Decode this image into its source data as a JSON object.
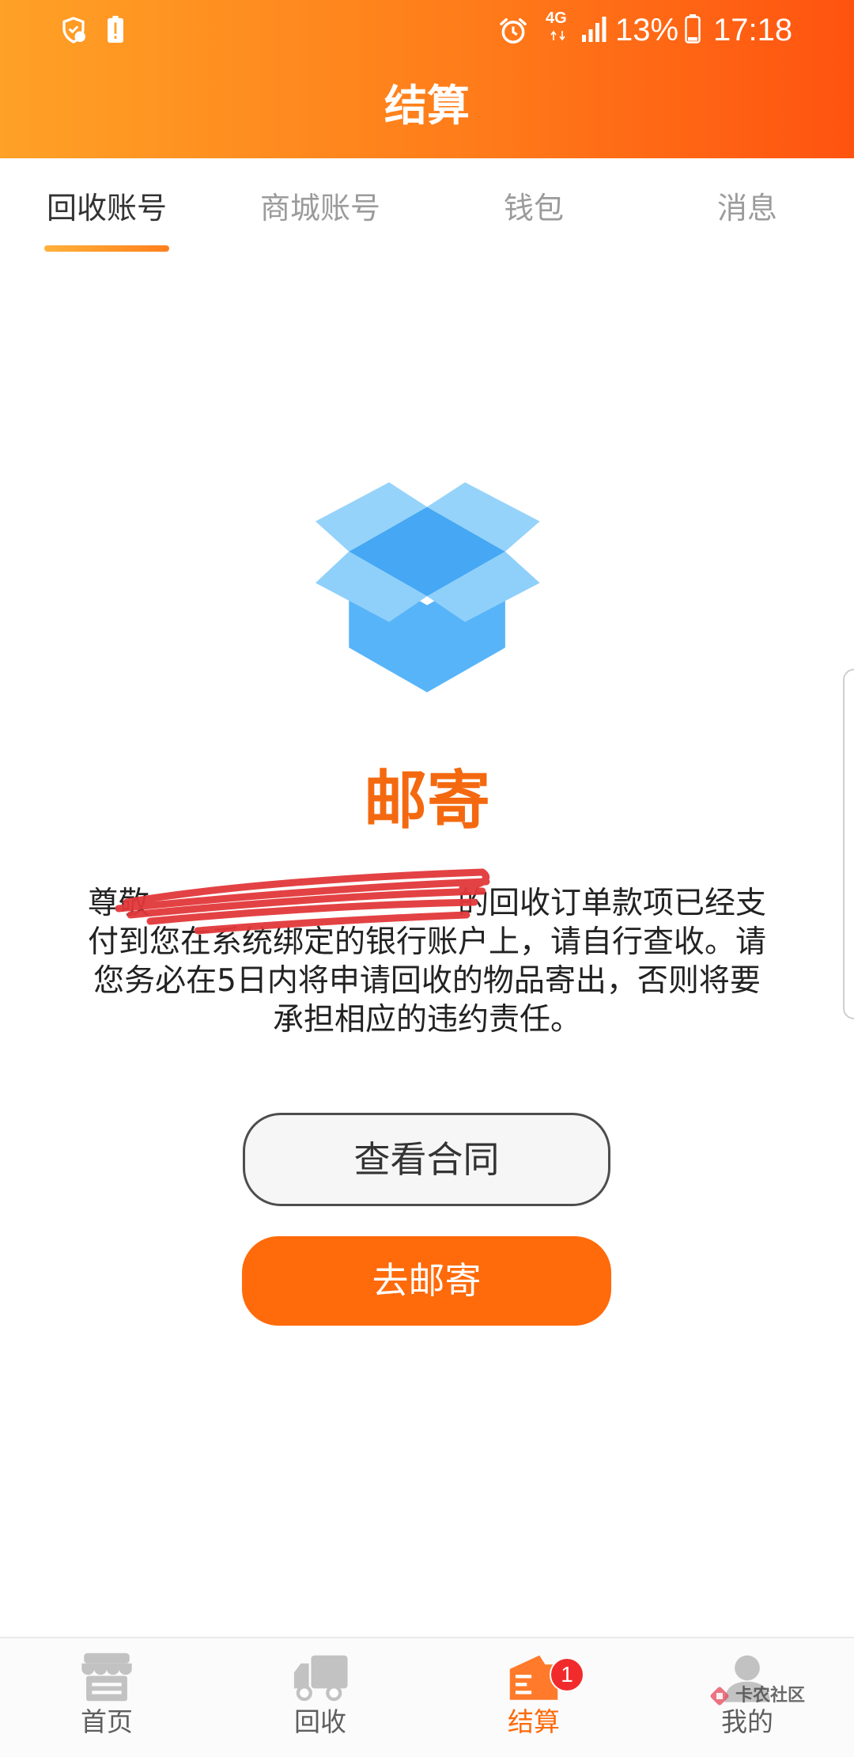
{
  "status_bar": {
    "left_icons": [
      "shield-notification-icon",
      "battery-alert-icon"
    ],
    "right_icons": [
      "alarm-icon",
      "signal-icon",
      "battery-icon"
    ],
    "network": "4G",
    "battery_level": "13%",
    "time": "17:18"
  },
  "header": {
    "title": "结算"
  },
  "tabs": [
    {
      "label": "回收账号",
      "active": true
    },
    {
      "label": "商城账号",
      "active": false
    },
    {
      "label": "钱包",
      "active": false
    },
    {
      "label": "消息",
      "active": false
    }
  ],
  "content": {
    "icon": "open-box-icon",
    "title": "邮寄",
    "message": {
      "line1_before_redaction": "尊敬",
      "line1_after_redaction": "的回收订单款项已经支",
      "line2": "付到您在系统绑定的银行账户上，请自行查收。请",
      "line3": "您务必在5日内将申请回收的物品寄出，否则将要",
      "line4": "承担相应的违约责任。"
    }
  },
  "buttons": {
    "view_contract": "查看合同",
    "go_mail": "去邮寄"
  },
  "bottom_nav": {
    "items": [
      {
        "label": "首页",
        "icon": "storefront-icon",
        "active": false
      },
      {
        "label": "回收",
        "icon": "truck-icon",
        "active": false
      },
      {
        "label": "结算",
        "icon": "settlement-icon",
        "active": true,
        "badge": "1"
      },
      {
        "label": "我的",
        "icon": "avatar-icon",
        "active": false
      }
    ]
  },
  "watermark": {
    "text": "卡农社区"
  },
  "colors": {
    "header_gradient_start": "#FFA126",
    "header_gradient_end": "#FF5310",
    "accent": "#FF6A0A",
    "title_orange": "#F4690F",
    "box_icon_blue": "#57B4F8",
    "badge_red": "#F12B2C",
    "redaction_red": "#E2383B",
    "inactive_icon": "#C2C2C2"
  }
}
